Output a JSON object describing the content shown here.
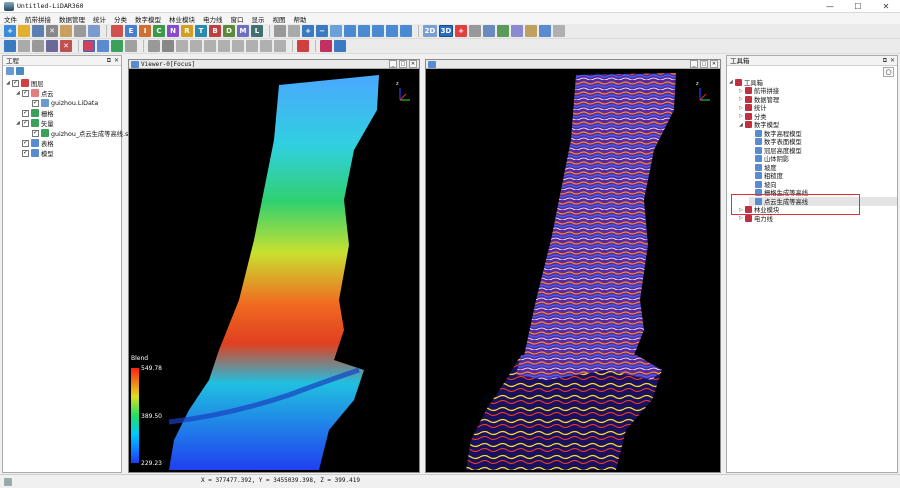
{
  "window": {
    "title": "Untitled-LiDAR360",
    "min": "—",
    "max": "☐",
    "close": "✕"
  },
  "menu": [
    "文件",
    "航带拼接",
    "数据管理",
    "统计",
    "分类",
    "数字模型",
    "林业模块",
    "电力线",
    "窗口",
    "显示",
    "视图",
    "帮助"
  ],
  "project_panel": {
    "title": "工程",
    "items": [
      {
        "label": "图层",
        "checked": true,
        "arrow": "◢"
      },
      {
        "label": "点云",
        "checked": true,
        "arrow": "◢"
      },
      {
        "label": "guizhou.LiData",
        "checked": true,
        "arrow": ""
      },
      {
        "label": "栅格",
        "checked": true,
        "arrow": ""
      },
      {
        "label": "矢量",
        "checked": true,
        "arrow": "◢"
      },
      {
        "label": "guizhou_点云生成等高线.sh",
        "checked": true,
        "arrow": ""
      },
      {
        "label": "表格",
        "checked": true,
        "arrow": ""
      },
      {
        "label": "模型",
        "checked": true,
        "arrow": ""
      }
    ]
  },
  "viewer0": {
    "title": "Viewer-0[Focus]"
  },
  "viewer1": {
    "title": ""
  },
  "legend": {
    "title": "Blend",
    "max": "549.78",
    "mid": "389.50",
    "min": "229.23"
  },
  "axis_labels": {
    "x": "x",
    "y": "y",
    "z": "z"
  },
  "toolbox": {
    "title": "工具箱",
    "items": [
      {
        "label": "工具箱",
        "arrow": "◢",
        "level": 0
      },
      {
        "label": "航带拼接",
        "arrow": "▷",
        "level": 1
      },
      {
        "label": "数据管理",
        "arrow": "▷",
        "level": 1
      },
      {
        "label": "统计",
        "arrow": "▷",
        "level": 1
      },
      {
        "label": "分类",
        "arrow": "▷",
        "level": 1
      },
      {
        "label": "数字模型",
        "arrow": "◢",
        "level": 1
      },
      {
        "label": "数字高程模型",
        "arrow": "",
        "level": 2
      },
      {
        "label": "数字表面模型",
        "arrow": "",
        "level": 2
      },
      {
        "label": "冠层高度模型",
        "arrow": "",
        "level": 2
      },
      {
        "label": "山体阴影",
        "arrow": "",
        "level": 2
      },
      {
        "label": "坡度",
        "arrow": "",
        "level": 2
      },
      {
        "label": "粗糙度",
        "arrow": "",
        "level": 2
      },
      {
        "label": "坡向",
        "arrow": "",
        "level": 2
      },
      {
        "label": "栅格生成等高线",
        "arrow": "",
        "level": 2
      },
      {
        "label": "点云生成等高线",
        "arrow": "",
        "level": 2
      },
      {
        "label": "林业模块",
        "arrow": "▷",
        "level": 1
      },
      {
        "label": "电力线",
        "arrow": "▷",
        "level": 1
      }
    ]
  },
  "status": {
    "coords": "X = 377477.392, Y = 3455039.398, Z = 399.419"
  },
  "toolbar_icons": {
    "row1": [
      "new",
      "open",
      "save",
      "delete",
      "folder",
      "stats",
      "grid",
      "3d"
    ],
    "view2d": "2D",
    "view3d": "3D"
  },
  "colors": {
    "highlight": "#e0303a",
    "accent": "#2a6fbf"
  }
}
